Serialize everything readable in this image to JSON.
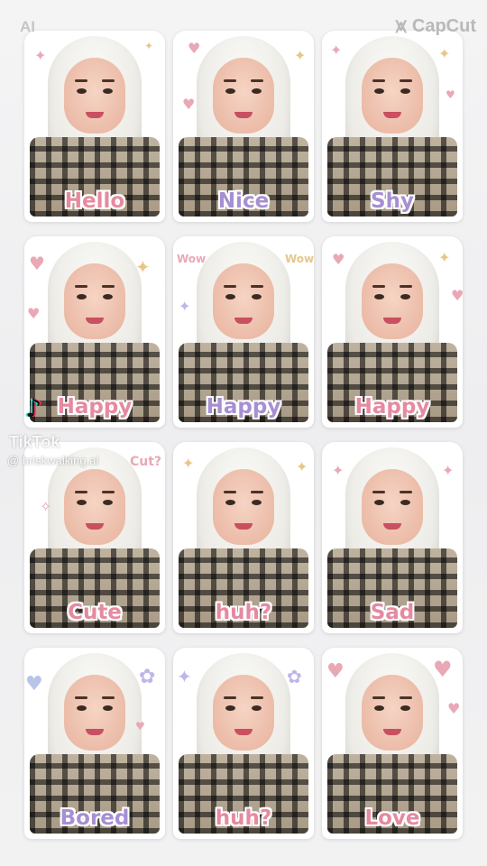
{
  "watermark": {
    "top_left": "AI",
    "app_name": "CapCut",
    "app_icon": "capcut-logo-icon",
    "tiktok_icon": "tiktok-logo-icon",
    "tiktok_name": "TikTok",
    "tiktok_handle": "@ briskwalking.ai"
  },
  "colors": {
    "label_pink": "#e58aa0",
    "label_purple": "#a68fd2",
    "background": "#f0f0f2"
  },
  "stickers": [
    {
      "label": "Hello",
      "color": "pink"
    },
    {
      "label": "Nice",
      "color": "purple"
    },
    {
      "label": "Shy",
      "color": "purple"
    },
    {
      "label": "Happy",
      "color": "pink"
    },
    {
      "label": "Happy",
      "color": "purple"
    },
    {
      "label": "Happy",
      "color": "pink"
    },
    {
      "label": "Cute",
      "color": "pink"
    },
    {
      "label": "huh?",
      "color": "pink"
    },
    {
      "label": "Sad",
      "color": "pink"
    },
    {
      "label": "Bored",
      "color": "purple"
    },
    {
      "label": "huh?",
      "color": "pink"
    },
    {
      "label": "Love",
      "color": "pink"
    }
  ],
  "decorations": {
    "wow": "Wow",
    "cute": "Cut?"
  }
}
